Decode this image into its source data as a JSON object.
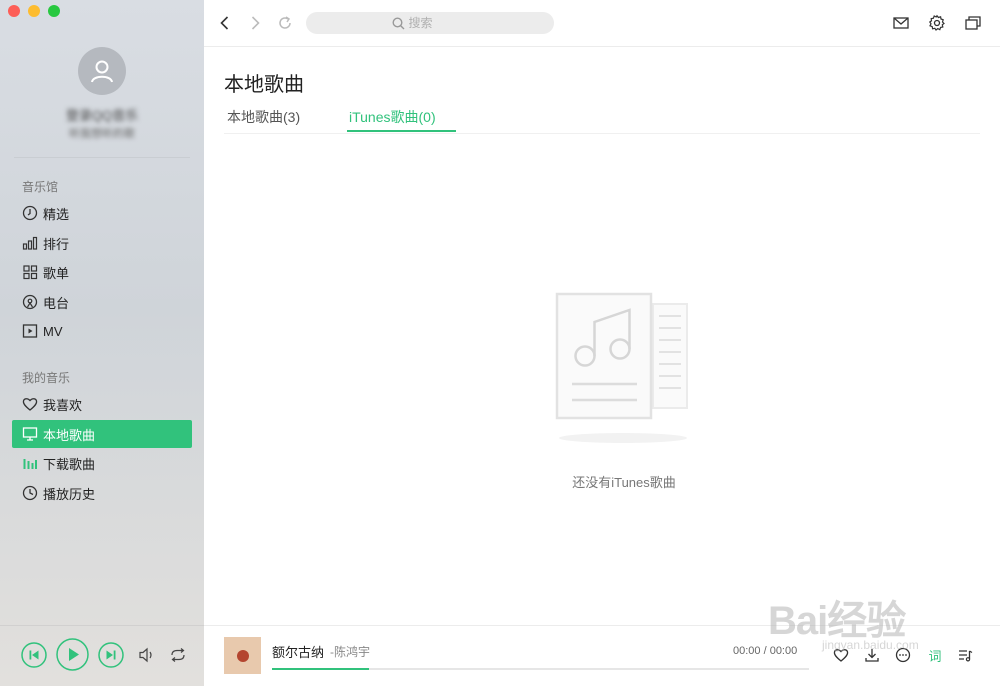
{
  "window": {
    "controls": [
      "close",
      "minimize",
      "maximize"
    ]
  },
  "sidebar": {
    "user": {
      "title": "登录QQ音乐",
      "subtitle": "听我想听的歌"
    },
    "sections": [
      {
        "title": "音乐馆",
        "items": [
          {
            "label": "精选",
            "icon": "featured-icon"
          },
          {
            "label": "排行",
            "icon": "chart-bars-icon"
          },
          {
            "label": "歌单",
            "icon": "grid-icon"
          },
          {
            "label": "电台",
            "icon": "radio-icon"
          },
          {
            "label": "MV",
            "icon": "video-icon"
          }
        ]
      },
      {
        "title": "我的音乐",
        "items": [
          {
            "label": "我喜欢",
            "icon": "heart-icon"
          },
          {
            "label": "本地歌曲",
            "icon": "monitor-icon",
            "active": true
          },
          {
            "label": "下载歌曲",
            "icon": "download-bars-icon"
          },
          {
            "label": "播放历史",
            "icon": "clock-icon"
          }
        ]
      }
    ]
  },
  "toolbar": {
    "search_placeholder": "搜索"
  },
  "main": {
    "title": "本地歌曲",
    "tabs": [
      {
        "label": "本地歌曲(3)",
        "active": false
      },
      {
        "label": "iTunes歌曲(0)",
        "active": true
      }
    ],
    "empty_message": "还没有iTunes歌曲"
  },
  "player": {
    "song": "额尔古纳",
    "artist": "-陈鸿宇",
    "time": "00:00 / 00:00",
    "progress": 0.18,
    "lyric_label": "词"
  },
  "watermark": {
    "main": "Bai经验",
    "sub": "jingyan.baidu.com"
  },
  "colors": {
    "accent": "#31c27c",
    "sidebar_bg": "#d5d9de"
  }
}
